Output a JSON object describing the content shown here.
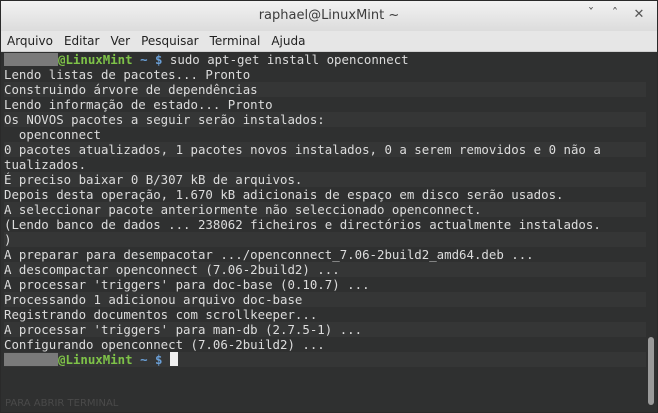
{
  "window": {
    "title": "raphael@LinuxMint ~",
    "buttons": [
      "ˇ",
      "ˆ",
      "✕"
    ]
  },
  "menu": [
    "Arquivo",
    "Editar",
    "Ver",
    "Pesquisar",
    "Terminal",
    "Ajuda"
  ],
  "prompt": {
    "host": "@LinuxMint",
    "path": " ~ $ "
  },
  "command": "sudo apt-get install openconnect",
  "output": [
    "Lendo listas de pacotes... Pronto",
    "Construindo árvore de dependências",
    "Lendo informação de estado... Pronto",
    "Os NOVOS pacotes a seguir serão instalados:",
    "  openconnect",
    "0 pacotes atualizados, 1 pacotes novos instalados, 0 a serem removidos e 0 não a",
    "tualizados.",
    "É preciso baixar 0 B/307 kB de arquivos.",
    "Depois desta operação, 1.670 kB adicionais de espaço em disco serão usados.",
    "A seleccionar pacote anteriormente não seleccionado openconnect.",
    "(Lendo banco de dados ... 238062 ficheiros e directórios actualmente instalados.",
    ")",
    "A preparar para desempacotar .../openconnect_7.06-2build2_amd64.deb ...",
    "A descompactar openconnect (7.06-2build2) ...",
    "A processar 'triggers' para doc-base (0.10.7) ...",
    "Processando 1 adicionou arquivo doc-base",
    "Registrando documentos com scrollkeeper...",
    "A processar 'triggers' para man-db (2.7.5-1) ...",
    "Configurando openconnect (7.06-2build2) ..."
  ],
  "ghost_text": "PARA ABRIR TERMINAL"
}
